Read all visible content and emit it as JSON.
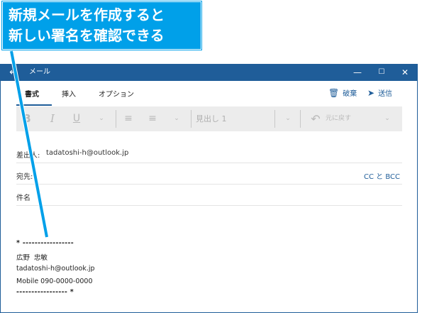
{
  "callout": {
    "line1": "新規メールを作成すると",
    "line2": "新しい署名を確認できる"
  },
  "window": {
    "title": "メール",
    "back_icon": "back-arrow-icon",
    "controls": {
      "minimize": "—",
      "maximize": "☐",
      "close": "✕"
    }
  },
  "ribbon": {
    "tabs": [
      "書式",
      "挿入",
      "オプション"
    ],
    "active_tab": "書式",
    "discard_label": "破棄",
    "send_label": "送信"
  },
  "toolbar": {
    "bold": "B",
    "italic": "I",
    "underline": "U",
    "style_value": "見出し 1",
    "undo_label": "元に戻す"
  },
  "fields": {
    "from_label": "差出人:",
    "from_value": "tadatoshi-h@outlook.jp",
    "to_label": "宛先:",
    "cc_bcc": "CC と BCC",
    "subject_label": "件名"
  },
  "signature": {
    "line1": "* -----------------",
    "line2": "広野  忠敏",
    "line3": "tadatoshi-h@outlook.jp",
    "line4": "Mobile 090-0000-0000",
    "line5": "----------------- *"
  },
  "colors": {
    "titlebar": "#1f5d99",
    "callout": "#00a0e9",
    "accent": "#1f5d99"
  }
}
